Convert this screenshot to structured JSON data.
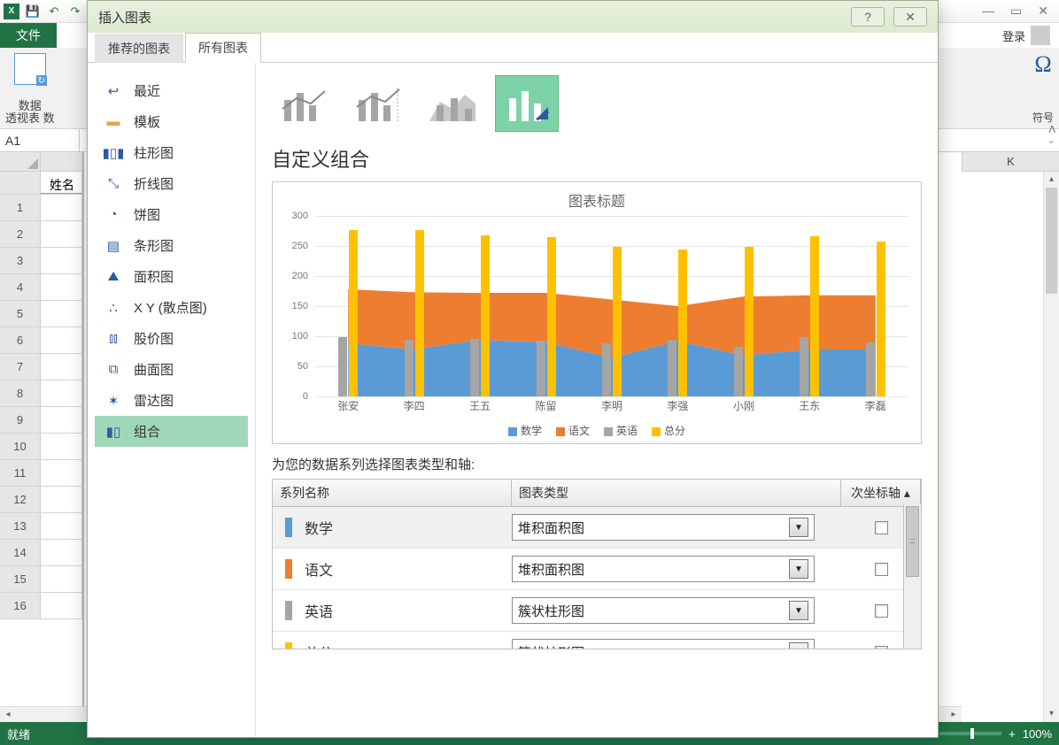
{
  "excel": {
    "file_tab": "文件",
    "login": "登录",
    "symbol_label": "符号",
    "pivot_label1": "数据",
    "pivot_label2": "透视表 数",
    "name_box": "A1",
    "colA_header_partial": "",
    "colK_header": "K",
    "cellA_label": "姓名",
    "status": "就绪",
    "zoom": "100%"
  },
  "dialog": {
    "title": "插入图表",
    "tabs": {
      "recommended": "推荐的图表",
      "all": "所有图表"
    },
    "categories": {
      "recent": "最近",
      "templates": "模板",
      "column": "柱形图",
      "line": "折线图",
      "pie": "饼图",
      "bar": "条形图",
      "area": "面积图",
      "scatter": "X Y (散点图)",
      "stock": "股价图",
      "surface": "曲面图",
      "radar": "雷达图",
      "combo": "组合"
    },
    "section_title": "自定义组合",
    "preview": {
      "chart_title": "图表标题",
      "legend": {
        "math": "数学",
        "chinese": "语文",
        "english": "英语",
        "total": "总分"
      }
    },
    "series_prompt": "为您的数据系列选择图表类型和轴:",
    "table_headers": {
      "name": "系列名称",
      "type": "图表类型",
      "axis": "次坐标轴"
    },
    "series_rows": {
      "math": {
        "name": "数学",
        "type": "堆积面积图"
      },
      "chinese": {
        "name": "语文",
        "type": "堆积面积图"
      },
      "english": {
        "name": "英语",
        "type": "簇状柱形图"
      },
      "total": {
        "name": "总分",
        "type": "簇状柱形图"
      }
    }
  },
  "chart_data": {
    "type": "combo",
    "title": "图表标题",
    "categories": [
      "张安",
      "李四",
      "王五",
      "陈留",
      "李明",
      "李强",
      "小刚",
      "王东",
      "李磊"
    ],
    "ylim": [
      0,
      300
    ],
    "y_ticks": [
      0,
      50,
      100,
      150,
      200,
      250,
      300
    ],
    "series": [
      {
        "name": "数学",
        "render": "stacked_area",
        "color": "#5b9bd5",
        "values": [
          88,
          78,
          94,
          90,
          64,
          92,
          68,
          78,
          78
        ]
      },
      {
        "name": "语文",
        "render": "stacked_area",
        "color": "#ed7d31",
        "values": [
          90,
          95,
          78,
          82,
          97,
          58,
          98,
          90,
          90
        ]
      },
      {
        "name": "英语",
        "render": "clustered_bar",
        "color": "#a5a5a5",
        "values": [
          98,
          94,
          96,
          92,
          88,
          94,
          82,
          98,
          90
        ]
      },
      {
        "name": "总分",
        "render": "clustered_bar",
        "color": "#ffc000",
        "values": [
          276,
          276,
          268,
          264,
          249,
          244,
          248,
          266,
          258
        ]
      }
    ]
  },
  "colors": {
    "blue": "#5b9bd5",
    "orange": "#ed7d31",
    "gray": "#a5a5a5",
    "yellow": "#ffc000",
    "sel": "#9fd8b9"
  }
}
